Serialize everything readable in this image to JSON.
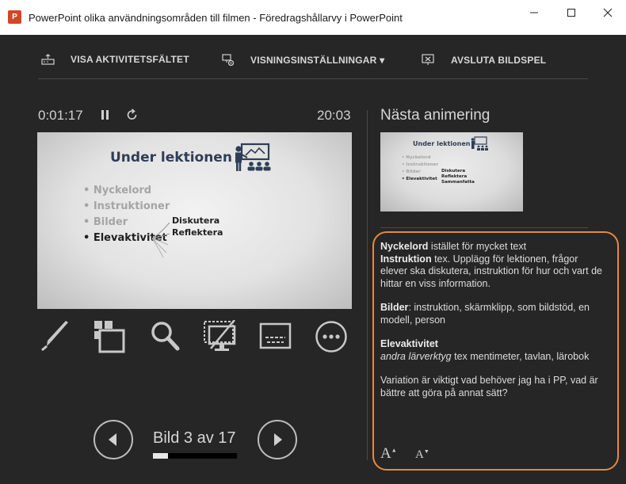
{
  "window": {
    "app_icon_letter": "P",
    "title": "PowerPoint olika användningsområden till filmen - Föredragshållarvy i PowerPoint"
  },
  "toolbar": {
    "taskbar_label": "VISA AKTIVITETSFÄLTET",
    "display_settings_label": "VISNINGSINSTÄLLNINGAR ▾",
    "end_show_label": "AVSLUTA BILDSPEL"
  },
  "timer": {
    "elapsed": "0:01:17",
    "clock": "20:03"
  },
  "current_slide": {
    "title": "Under lektionen",
    "bullets": [
      "• Nyckelord",
      "• Instruktioner",
      "• Bilder",
      "• Elevaktivitet"
    ],
    "active_bullet_index": 3,
    "sub_items": [
      "Diskutera",
      "Reflektera"
    ]
  },
  "tools": [
    "pen-tool",
    "see-all-slides",
    "zoom",
    "black-screen",
    "subtitles",
    "more-options"
  ],
  "navigation": {
    "counter": "Bild 3 av 17",
    "progress": 0.18
  },
  "next_panel": {
    "label": "Nästa animering",
    "thumb": {
      "title": "Under lektionen",
      "bullets": [
        "• Nyckelord",
        "• Instruktioner",
        "• Bilder",
        "• Elevaktivitet"
      ],
      "sub_items": [
        "Diskutera",
        "Reflektera",
        "Sammanfatta"
      ]
    }
  },
  "notes": {
    "p1_b1": "Nyckelord",
    "p1_t1": " istället för mycket text",
    "p1_b2": "Instruktion",
    "p1_t2": " tex. Upplägg för lektionen, frågor elever ska diskutera, instruktion för hur och vart de hittar en viss information.",
    "p2_b": "Bilder",
    "p2_t": ": instruktion, skärmklipp, som bildstöd, en modell, person",
    "p3_b": "Elevaktivitet",
    "p3_i": "andra lärverktyg",
    "p3_t": " tex mentimeter, tavlan, lärobok",
    "p4": "Variation är viktigt vad behöver jag ha i PP, vad är bättre att göra på annat sätt?",
    "font_increase": "A",
    "font_decrease": "A"
  },
  "colors": {
    "background": "#262626",
    "highlight_border": "#e8893c",
    "title_blue": "#2f3e55"
  }
}
